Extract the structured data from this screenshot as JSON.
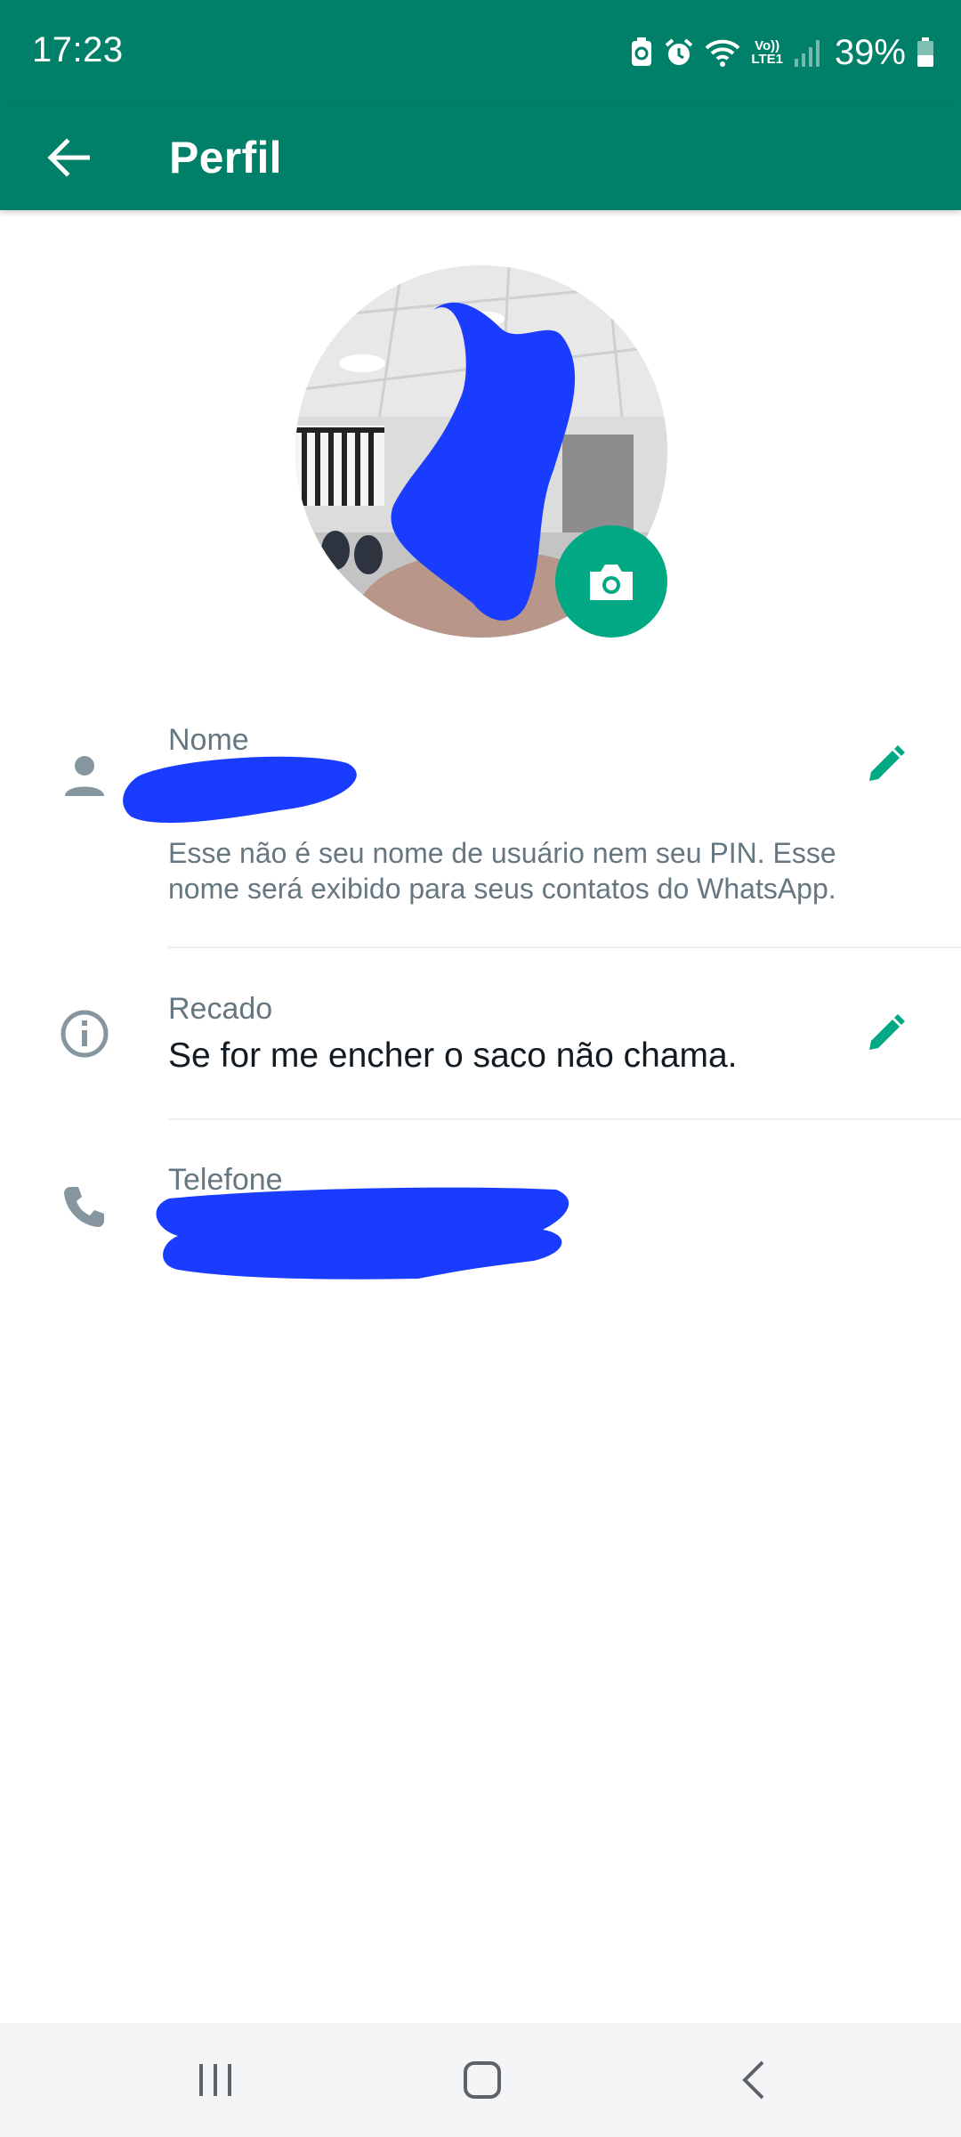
{
  "status_bar": {
    "time": "17:23",
    "battery_percent": "39%",
    "network_label_top": "Vo))",
    "network_label_bottom": "LTE1",
    "icons": [
      "battery-saver-icon",
      "alarm-icon",
      "wifi-icon",
      "volte-icon",
      "signal-icon",
      "battery-icon"
    ]
  },
  "app_bar": {
    "title": "Perfil",
    "back_icon": "arrow-left-icon"
  },
  "profile_photo": {
    "camera_icon": "camera-icon"
  },
  "fields": {
    "name": {
      "label": "Nome",
      "hint": "Esse não é seu nome de usuário nem seu PIN. Esse nome será exibido para seus contatos do WhatsApp.",
      "icon": "person-icon",
      "edit_icon": "pencil-icon"
    },
    "about": {
      "label": "Recado",
      "value": "Se for me encher o saco não chama.",
      "icon": "info-icon",
      "edit_icon": "pencil-icon"
    },
    "phone": {
      "label": "Telefone",
      "icon": "phone-icon"
    }
  },
  "nav_bar": {
    "icons": [
      "recent-apps-icon",
      "home-icon",
      "back-icon"
    ]
  },
  "colors": {
    "header": "#008069",
    "accent": "#00a884",
    "secondary_text": "#667781",
    "primary_text": "#111b21",
    "redaction": "#1a3cff"
  }
}
